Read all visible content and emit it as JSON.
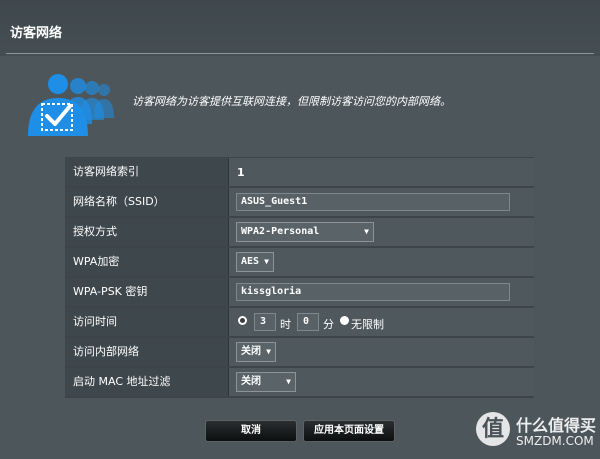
{
  "page": {
    "title": "访客网络",
    "description": "访客网络为访客提供互联网连接，但限制访客访问您的内部网络。"
  },
  "settings": {
    "index": {
      "label": "访客网络索引",
      "value": "1"
    },
    "ssid": {
      "label": "网络名称（SSID）",
      "value": "ASUS_Guest1"
    },
    "auth": {
      "label": "授权方式",
      "value": "WPA2-Personal"
    },
    "wpa_enc": {
      "label": "WPA加密",
      "value": "AES"
    },
    "psk": {
      "label": "WPA-PSK 密钥",
      "value": "kissgloria"
    },
    "access_time": {
      "label": "访问时间",
      "hours": "3",
      "hours_unit": "时",
      "minutes": "0",
      "minutes_unit": "分",
      "unlimited_label": "无限制",
      "selected": "timed"
    },
    "intranet": {
      "label": "访问内部网络",
      "value": "关闭"
    },
    "mac_filter": {
      "label": "启动 MAC 地址过滤",
      "value": "关闭"
    }
  },
  "buttons": {
    "cancel": "取消",
    "apply": "应用本页面设置"
  },
  "watermark": {
    "glyph": "值",
    "line1": "什么值得买",
    "line2": "SMZDM.COM"
  },
  "icons": {
    "users": "guest-users-icon",
    "dropdown": "chevron-down-icon"
  },
  "colors": {
    "background": "#4d565b",
    "label_cell": "#3e474b",
    "value_cell": "#4e585d",
    "icon_blue": "#1e8ee6"
  }
}
